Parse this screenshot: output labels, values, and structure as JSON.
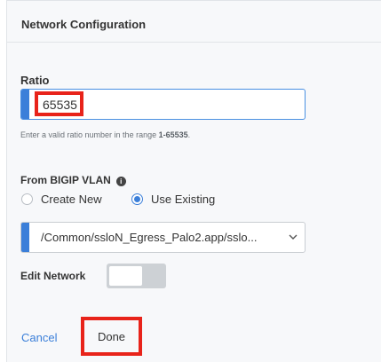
{
  "panel": {
    "title": "Network Configuration"
  },
  "ratio": {
    "label": "Ratio",
    "value": "65535",
    "helper_prefix": "Enter a valid ratio number in the range ",
    "helper_range": "1-65535",
    "helper_suffix": "."
  },
  "vlan": {
    "label": "From BIGIP VLAN",
    "info_glyph": "i",
    "options": [
      "Create New",
      "Use Existing"
    ],
    "selected_option": "Use Existing",
    "selected_value": "/Common/ssloN_Egress_Palo2.app/sslo..."
  },
  "edit_network": {
    "label": "Edit Network",
    "enabled": false
  },
  "footer": {
    "cancel_label": "Cancel",
    "done_label": "Done"
  },
  "colors": {
    "accent": "#3b7fd9",
    "highlight": "#e8231a",
    "panel_bg": "#f7f8fa"
  },
  "icons": [
    "info-icon",
    "chevron-down-icon"
  ]
}
